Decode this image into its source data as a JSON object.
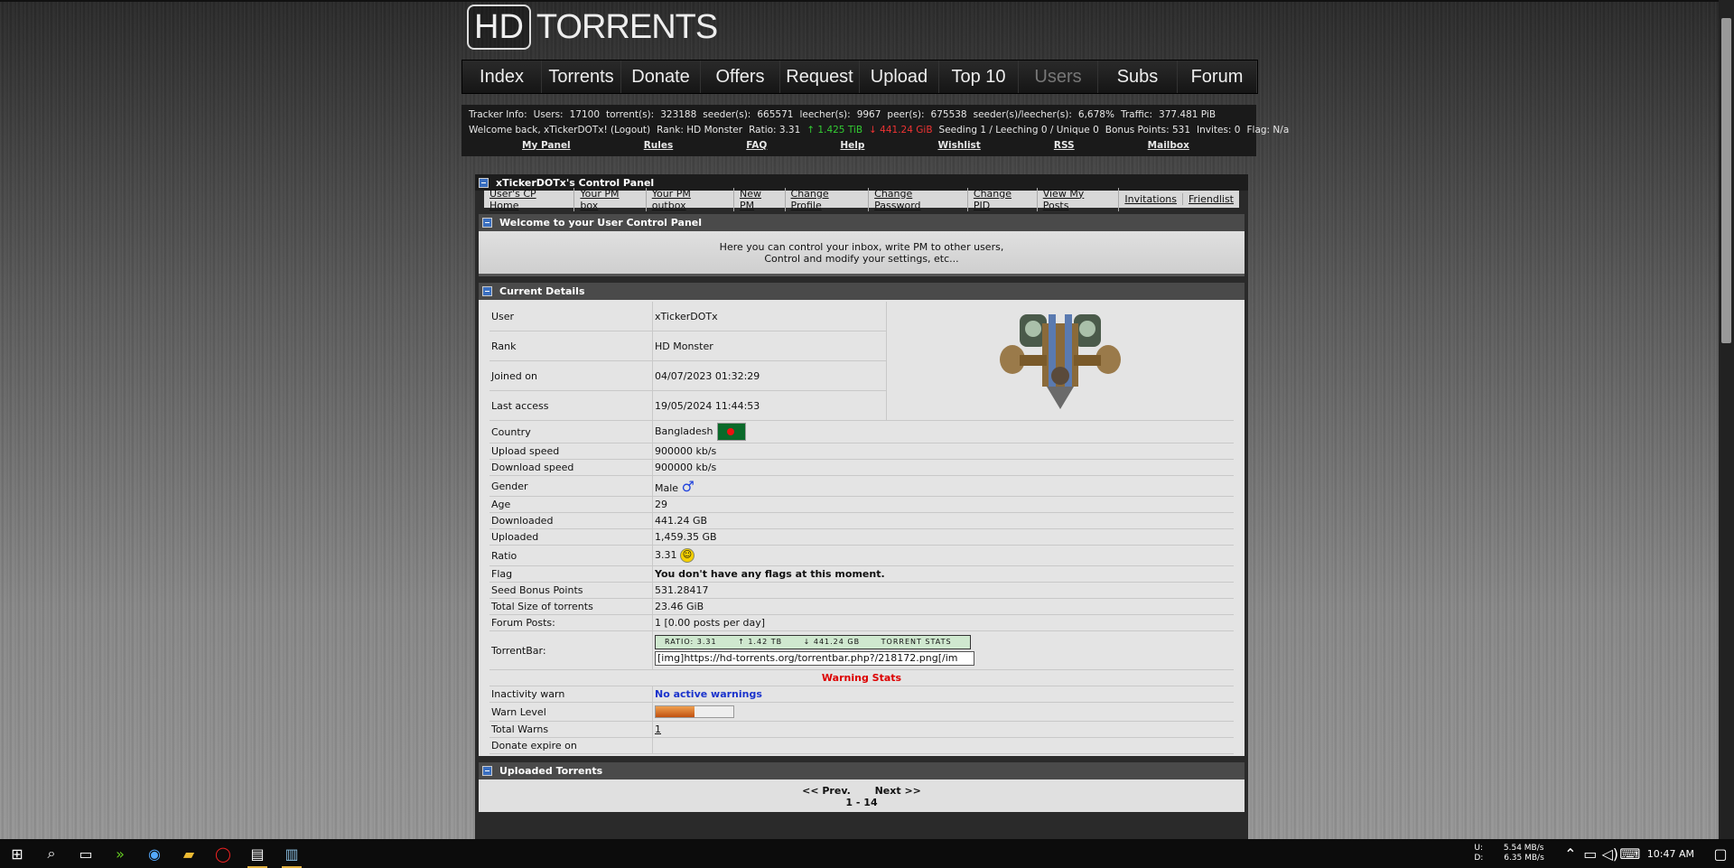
{
  "logo": {
    "hd": "HD",
    "text": "TORRENTS"
  },
  "nav": [
    "Index",
    "Torrents",
    "Donate",
    "Offers",
    "Request",
    "Upload",
    "Top 10",
    "Users",
    "Subs",
    "Forum"
  ],
  "tracker": {
    "label": "Tracker Info:",
    "users_label": "Users:",
    "users": "17100",
    "torrents_label": "torrent(s):",
    "torrents": "323188",
    "seeders_label": "seeder(s):",
    "seeders": "665571",
    "leechers_label": "leecher(s):",
    "leechers": "9967",
    "peers_label": "peer(s):",
    "peers": "675538",
    "ratio_label": "seeder(s)/leecher(s):",
    "ratio": "6,678%",
    "traffic_label": "Traffic:",
    "traffic": "377.481 PiB"
  },
  "welcome_bar": {
    "greeting": "Welcome back, xTickerDOTx! (Logout)",
    "rank": "Rank: HD Monster",
    "ratio": "Ratio: 3.31",
    "up": "↑ 1.425 TiB",
    "down": "↓ 441.24 GiB",
    "seeding": "Seeding 1 / Leeching 0 / Unique 0",
    "bonus": "Bonus Points: 531",
    "invites": "Invites: 0",
    "flag": "Flag: N/a"
  },
  "quick_links": [
    "My Panel",
    "Rules",
    "FAQ",
    "Help",
    "Wishlist",
    "RSS",
    "Mailbox"
  ],
  "panel_title": "xTickerDOTx's Control Panel",
  "tabs": [
    "User's CP Home",
    "Your PM box",
    "Your PM outbox",
    "New PM",
    "Change Profile",
    "Change Password",
    "Change PID",
    "View My Posts",
    "Invitations",
    "Friendlist"
  ],
  "welcome_section": {
    "title": "Welcome to your User Control Panel",
    "line1": "Here you can control your inbox, write PM to other users,",
    "line2": "Control and modify your settings, etc..."
  },
  "details_title": "Current Details",
  "details_top": [
    {
      "k": "User",
      "v": "xTickerDOTx"
    },
    {
      "k": "Rank",
      "v": "HD Monster"
    },
    {
      "k": "Joined on",
      "v": "04/07/2023 01:32:29"
    },
    {
      "k": "Last access",
      "v": "19/05/2024 11:44:53"
    }
  ],
  "details": {
    "country_k": "Country",
    "country": "Bangladesh",
    "upspeed_k": "Upload speed",
    "upspeed": "900000 kb/s",
    "downspeed_k": "Download speed",
    "downspeed": "900000 kb/s",
    "gender_k": "Gender",
    "gender": "Male",
    "age_k": "Age",
    "age": "29",
    "downloaded_k": "Downloaded",
    "downloaded": "441.24 GB",
    "uploaded_k": "Uploaded",
    "uploaded": "1,459.35 GB",
    "ratio_k": "Ratio",
    "ratio": "3.31",
    "flag_k": "Flag",
    "flag": "You don't have any flags at this moment.",
    "bonus_k": "Seed Bonus Points",
    "bonus": "531.28417",
    "size_k": "Total Size of torrents",
    "size": "23.46 GiB",
    "posts_k": "Forum Posts:",
    "posts": "1   [0.00 posts per day]",
    "tbar_k": "TorrentBar:",
    "tbar_ratio": "RATIO: 3.31",
    "tbar_up": "↑ 1.42 TB",
    "tbar_down": "↓ 441.24 GB",
    "tbar_stats": "TORRENT STATS",
    "tbar_code": "[img]https://hd-torrents.org/torrentbar.php?/218172.png[/im",
    "warn_heading": "Warning Stats",
    "inactivity_k": "Inactivity warn",
    "inactivity": "No active warnings",
    "warnlevel_k": "Warn Level",
    "warnlevel_value": 0.5,
    "totalwarns_k": "Total Warns",
    "totalwarns": "1",
    "donate_k": "Donate expire on",
    "donate": ""
  },
  "uploaded_title": "Uploaded Torrents",
  "pager": {
    "prev": "<< Prev.",
    "next": "Next >>",
    "range": "1 - 14"
  },
  "taskbar": {
    "up_label": "U:",
    "up_speed": "5.54 MB/s",
    "down_label": "D:",
    "down_speed": "6.35 MB/s",
    "time": "10:47 AM"
  },
  "colors": {
    "accent_green": "#33cc33",
    "accent_red": "#ee3333",
    "warn_red": "#dd0000",
    "link_blue": "#1a33cc"
  }
}
